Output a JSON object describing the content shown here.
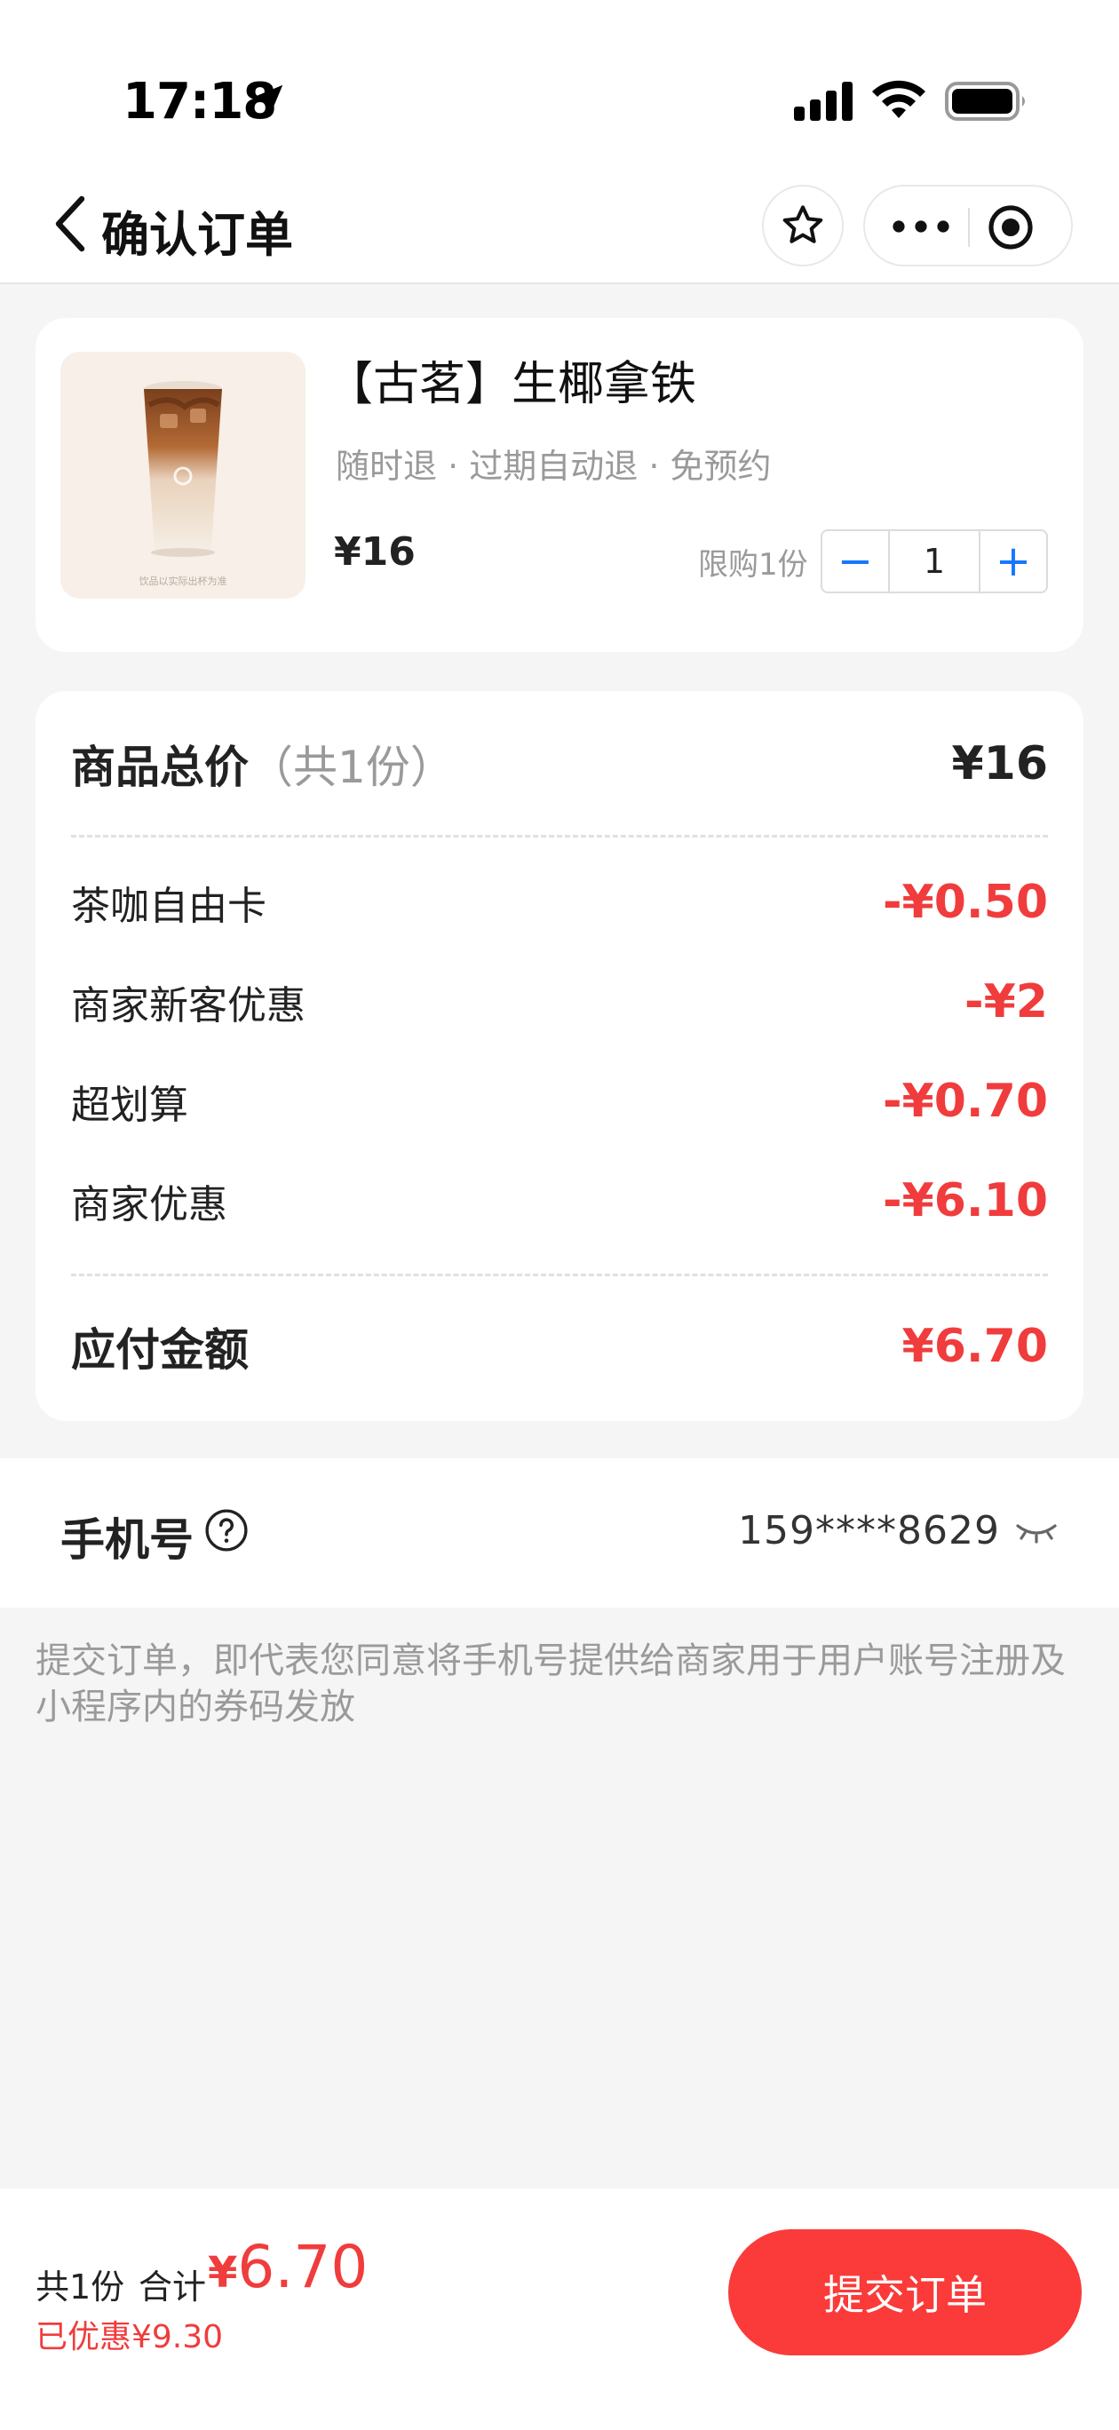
{
  "status_bar": {
    "time": "17:18"
  },
  "nav": {
    "title": "确认订单"
  },
  "product": {
    "name": "【古茗】生椰拿铁",
    "tags": "随时退 · 过期自动退 · 免预约",
    "price": "¥16",
    "limit": "限购1份",
    "minus_label": "−",
    "quantity": "1",
    "plus_label": "+",
    "image_caption": "饮品以实际出杯为准"
  },
  "price_summary": {
    "total_label": "商品总价",
    "total_count": "（共1份）",
    "total_value": "¥16",
    "discounts": [
      {
        "label": "茶咖自由卡",
        "value": "-¥0.50"
      },
      {
        "label": "商家新客优惠",
        "value": "-¥2"
      },
      {
        "label": "超划算",
        "value": "-¥0.70"
      },
      {
        "label": "商家优惠",
        "value": "-¥6.10"
      }
    ],
    "payable_label": "应付金额",
    "payable_value": "¥6.70"
  },
  "phone": {
    "label": "手机号",
    "value": "159****8629"
  },
  "notice": "提交订单，即代表您同意将手机号提供给商家用于用户账号注册及小程序内的券码发放",
  "bottom_bar": {
    "count": "共1份",
    "total_label": "合计",
    "total_currency": "¥",
    "total_amount": "6.70",
    "saved": "已优惠¥9.30",
    "submit_label": "提交订单"
  },
  "colors": {
    "accent_red": "#f03c3c",
    "button_red": "#fb3a3a",
    "stepper_blue": "#1677ff"
  },
  "icons": [
    "location-arrow-icon",
    "signal-icon",
    "wifi-icon",
    "battery-icon",
    "back-chevron-icon",
    "star-icon",
    "more-dots-icon",
    "target-icon",
    "help-icon",
    "eye-closed-icon"
  ]
}
